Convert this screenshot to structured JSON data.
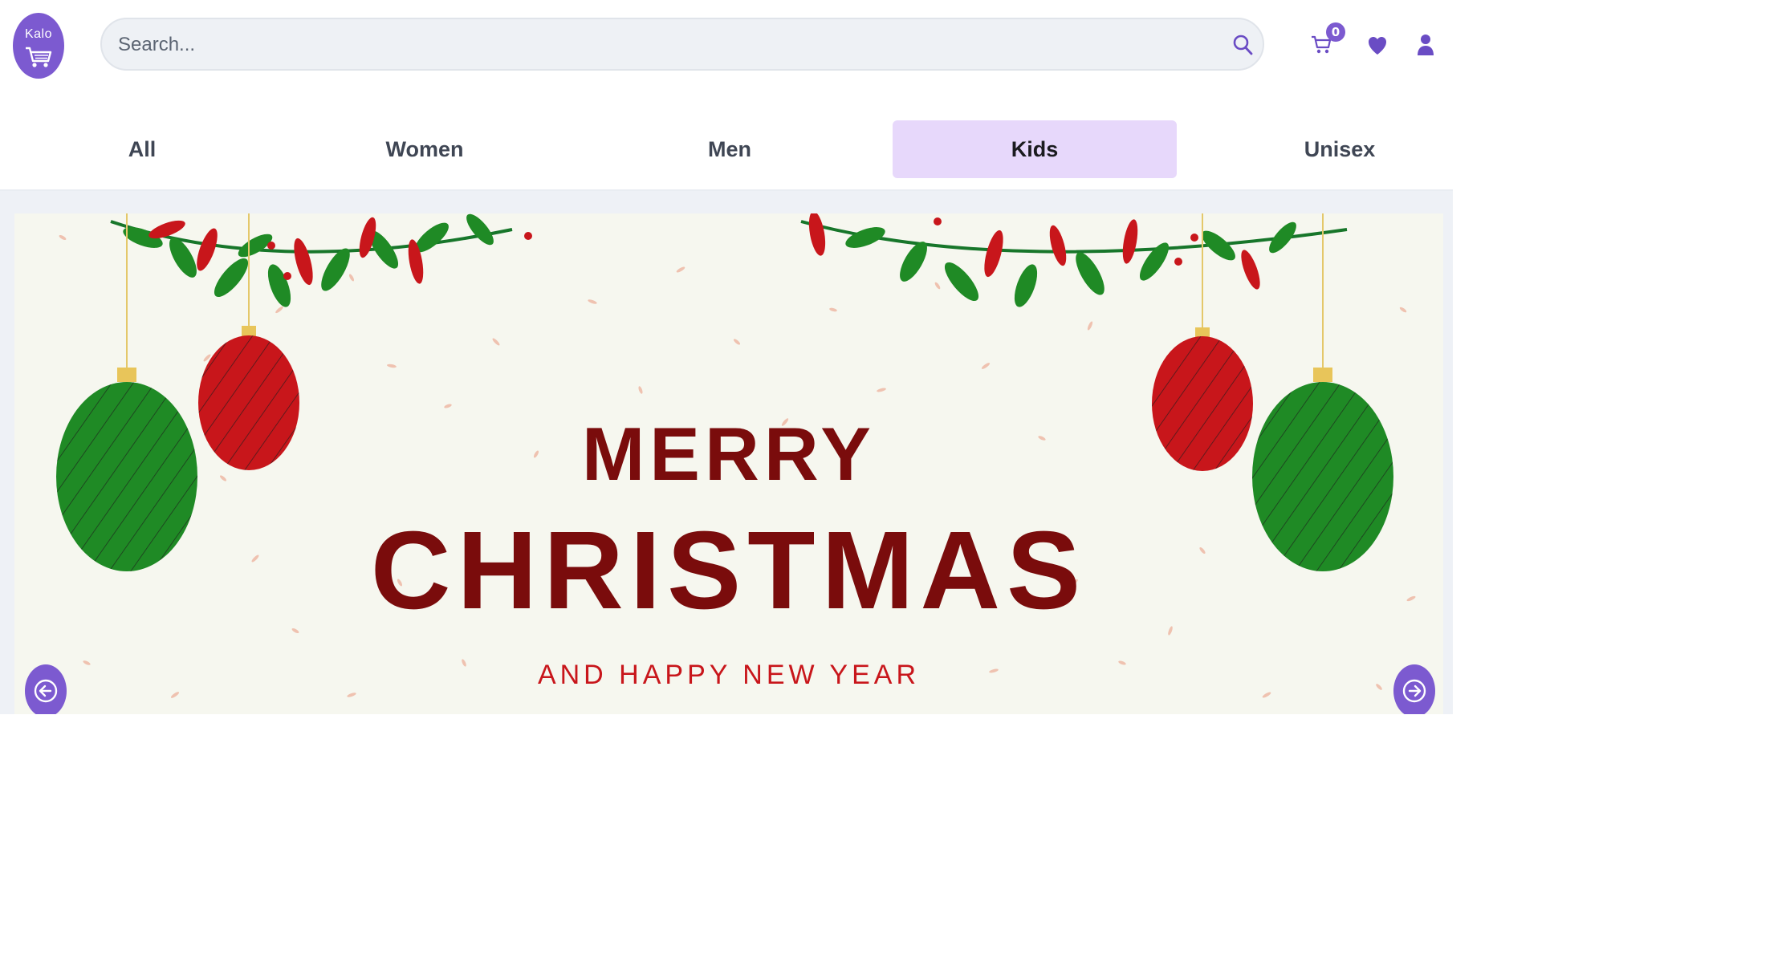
{
  "header": {
    "logo_text": "Kalo",
    "search_placeholder": "Search...",
    "cart_count": "0"
  },
  "tabs": [
    {
      "label": "All",
      "active": false
    },
    {
      "label": "Women",
      "active": false
    },
    {
      "label": "Men",
      "active": false
    },
    {
      "label": "Kids",
      "active": true
    },
    {
      "label": "Unisex",
      "active": false
    }
  ],
  "banner": {
    "line1": "MERRY",
    "line2": "CHRISTMAS",
    "line3": "AND HAPPY NEW YEAR"
  },
  "icons": {
    "logo": "cart-logo-icon",
    "search": "search-icon",
    "cart": "cart-icon",
    "wishlist": "heart-icon",
    "account": "user-icon",
    "prev": "arrow-left-circle-icon",
    "next": "arrow-right-circle-icon"
  },
  "colors": {
    "accent": "#7c5ad0",
    "active_tab_bg": "#e7d8fb",
    "banner_text": "#7a0c0c",
    "ornament_red": "#c8161b",
    "ornament_green": "#1f8a25"
  }
}
